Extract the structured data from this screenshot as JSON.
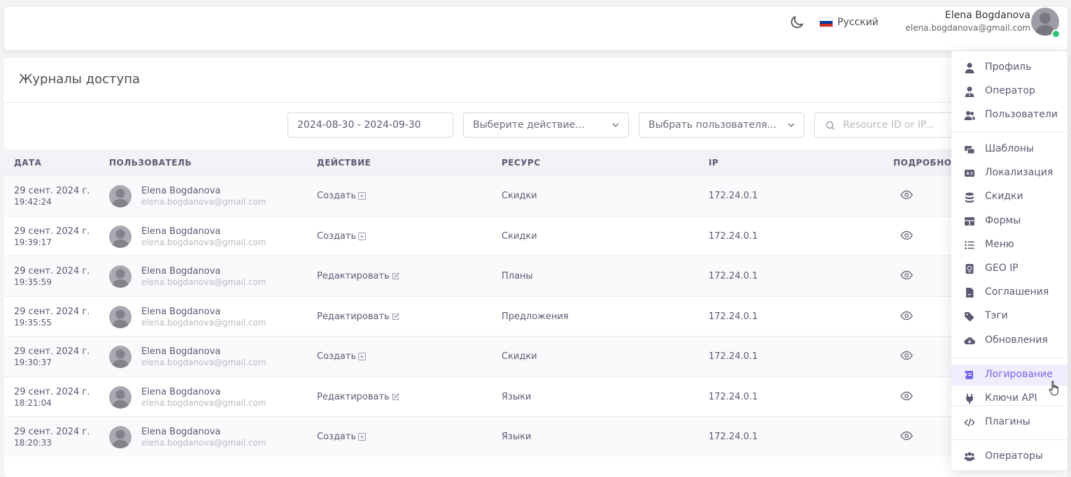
{
  "header": {
    "language": "Русский",
    "user_name": "Elena Bogdanova",
    "user_email": "elena.bogdanova@gmail.com"
  },
  "page": {
    "title": "Журналы доступа",
    "filters": {
      "date_range": "2024-08-30 - 2024-09-30",
      "action_placeholder": "Выберите действие...",
      "user_placeholder": "Выбрать пользователя...",
      "search_placeholder": "Resource ID or IP..."
    },
    "columns": [
      "ДАТА",
      "ПОЛЬЗОВАТЕЛЬ",
      "ДЕЙСТВИЕ",
      "РЕСУРС",
      "IP",
      "ПОДРОБНОСТИ"
    ],
    "rows": [
      {
        "date": "29 сент. 2024 г.",
        "time": "19:42:24",
        "user": "Elena Bogdanova",
        "email": "elena.bogdanova@gmail.com",
        "action": "Создать",
        "resource": "Скидки",
        "ip": "172.24.0.1"
      },
      {
        "date": "29 сент. 2024 г.",
        "time": "19:39:17",
        "user": "Elena Bogdanova",
        "email": "elena.bogdanova@gmail.com",
        "action": "Создать",
        "resource": "Скидки",
        "ip": "172.24.0.1"
      },
      {
        "date": "29 сент. 2024 г.",
        "time": "19:35:59",
        "user": "Elena Bogdanova",
        "email": "elena.bogdanova@gmail.com",
        "action": "Редактировать",
        "resource": "Планы",
        "ip": "172.24.0.1"
      },
      {
        "date": "29 сент. 2024 г.",
        "time": "19:35:55",
        "user": "Elena Bogdanova",
        "email": "elena.bogdanova@gmail.com",
        "action": "Редактировать",
        "resource": "Предложения",
        "ip": "172.24.0.1"
      },
      {
        "date": "29 сент. 2024 г.",
        "time": "19:30:37",
        "user": "Elena Bogdanova",
        "email": "elena.bogdanova@gmail.com",
        "action": "Создать",
        "resource": "Скидки",
        "ip": "172.24.0.1"
      },
      {
        "date": "29 сент. 2024 г.",
        "time": "18:21:04",
        "user": "Elena Bogdanova",
        "email": "elena.bogdanova@gmail.com",
        "action": "Редактировать",
        "resource": "Языки",
        "ip": "172.24.0.1"
      },
      {
        "date": "29 сент. 2024 г.",
        "time": "18:20:33",
        "user": "Elena Bogdanova",
        "email": "elena.bogdanova@gmail.com",
        "action": "Создать",
        "resource": "Языки",
        "ip": "172.24.0.1"
      }
    ]
  },
  "menu": {
    "items": [
      {
        "label": "Профиль",
        "icon": "user-icon"
      },
      {
        "label": "Оператор",
        "icon": "operator-icon"
      },
      {
        "label": "Пользователи",
        "icon": "users-icon"
      },
      {
        "label": "Шаблоны",
        "icon": "templates-icon"
      },
      {
        "label": "Локализация",
        "icon": "localization-icon"
      },
      {
        "label": "Скидки",
        "icon": "coins-icon"
      },
      {
        "label": "Формы",
        "icon": "forms-icon"
      },
      {
        "label": "Меню",
        "icon": "list-icon"
      },
      {
        "label": "GEO IP",
        "icon": "passport-icon"
      },
      {
        "label": "Соглашения",
        "icon": "contract-icon"
      },
      {
        "label": "Тэги",
        "icon": "tags-icon"
      },
      {
        "label": "Обновления",
        "icon": "cloud-download-icon"
      },
      {
        "label": "Логирование",
        "icon": "scroll-icon"
      },
      {
        "label": "Ключи API",
        "icon": "plug-icon"
      },
      {
        "label": "Плагины",
        "icon": "code-icon"
      },
      {
        "label": "Операторы",
        "icon": "operators-icon"
      }
    ],
    "active": "Логирование"
  },
  "colors": {
    "accent": "#7367f0",
    "online": "#28c76f"
  }
}
